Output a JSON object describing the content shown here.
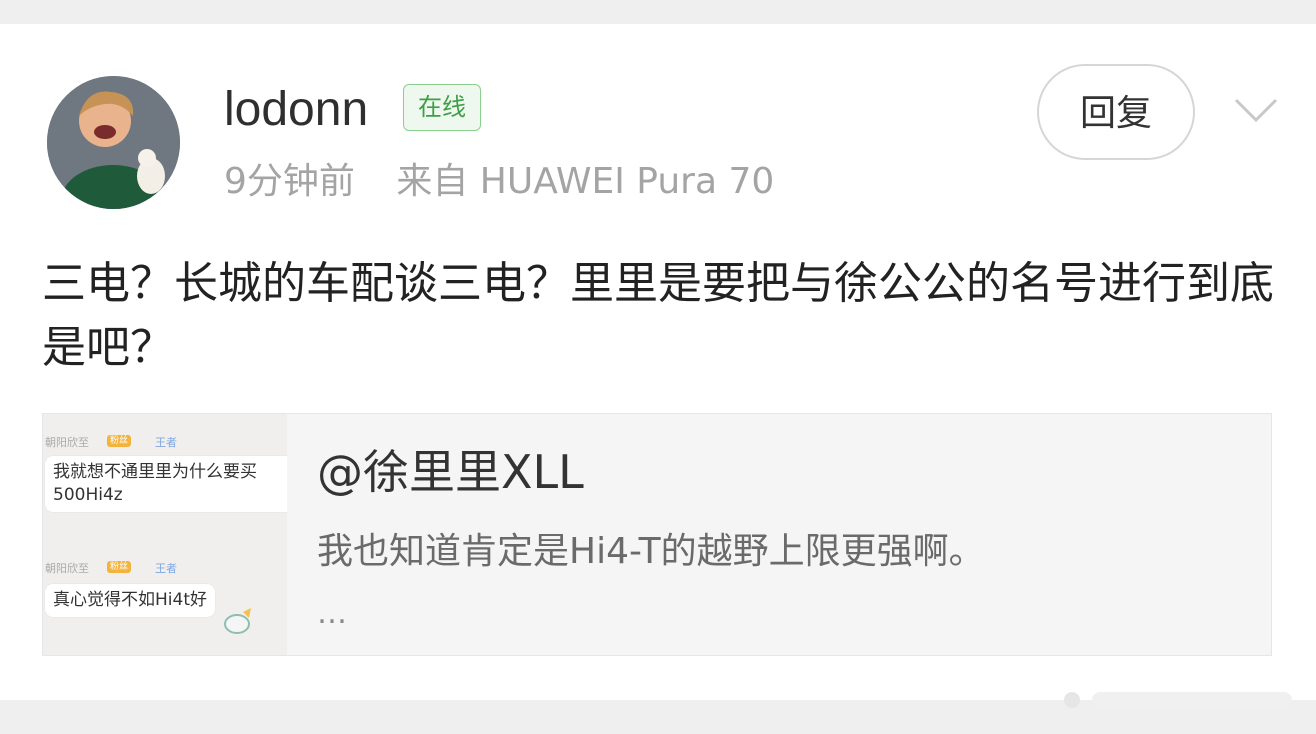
{
  "post": {
    "username": "lodonn",
    "online_badge": "在线",
    "time": "9分钟前",
    "source": "来自 HUAWEI Pura 70",
    "content": "三电？长城的车配谈三电？里里是要把与徐公公的名号进行到底是吧？"
  },
  "actions": {
    "reply_label": "回复"
  },
  "quote": {
    "author": "@徐里里XLL",
    "text": "我也知道肯定是Hi4-T的越野上限更强啊。",
    "more": "…"
  },
  "thumbnail": {
    "name1": "朝阳欣至",
    "tag1": "粉丝",
    "tag1b": "王者",
    "msg1": "我就想不通里里为什么要买500Hi4z",
    "name2": "朝阳欣至",
    "tag2": "粉丝",
    "tag2b": "王者",
    "msg2": "真心觉得不如Hi4t好"
  },
  "colors": {
    "online_green": "#3f9f48",
    "meta_gray": "#a4a4a4"
  },
  "icons": {
    "expand": "chevron-down-icon"
  }
}
